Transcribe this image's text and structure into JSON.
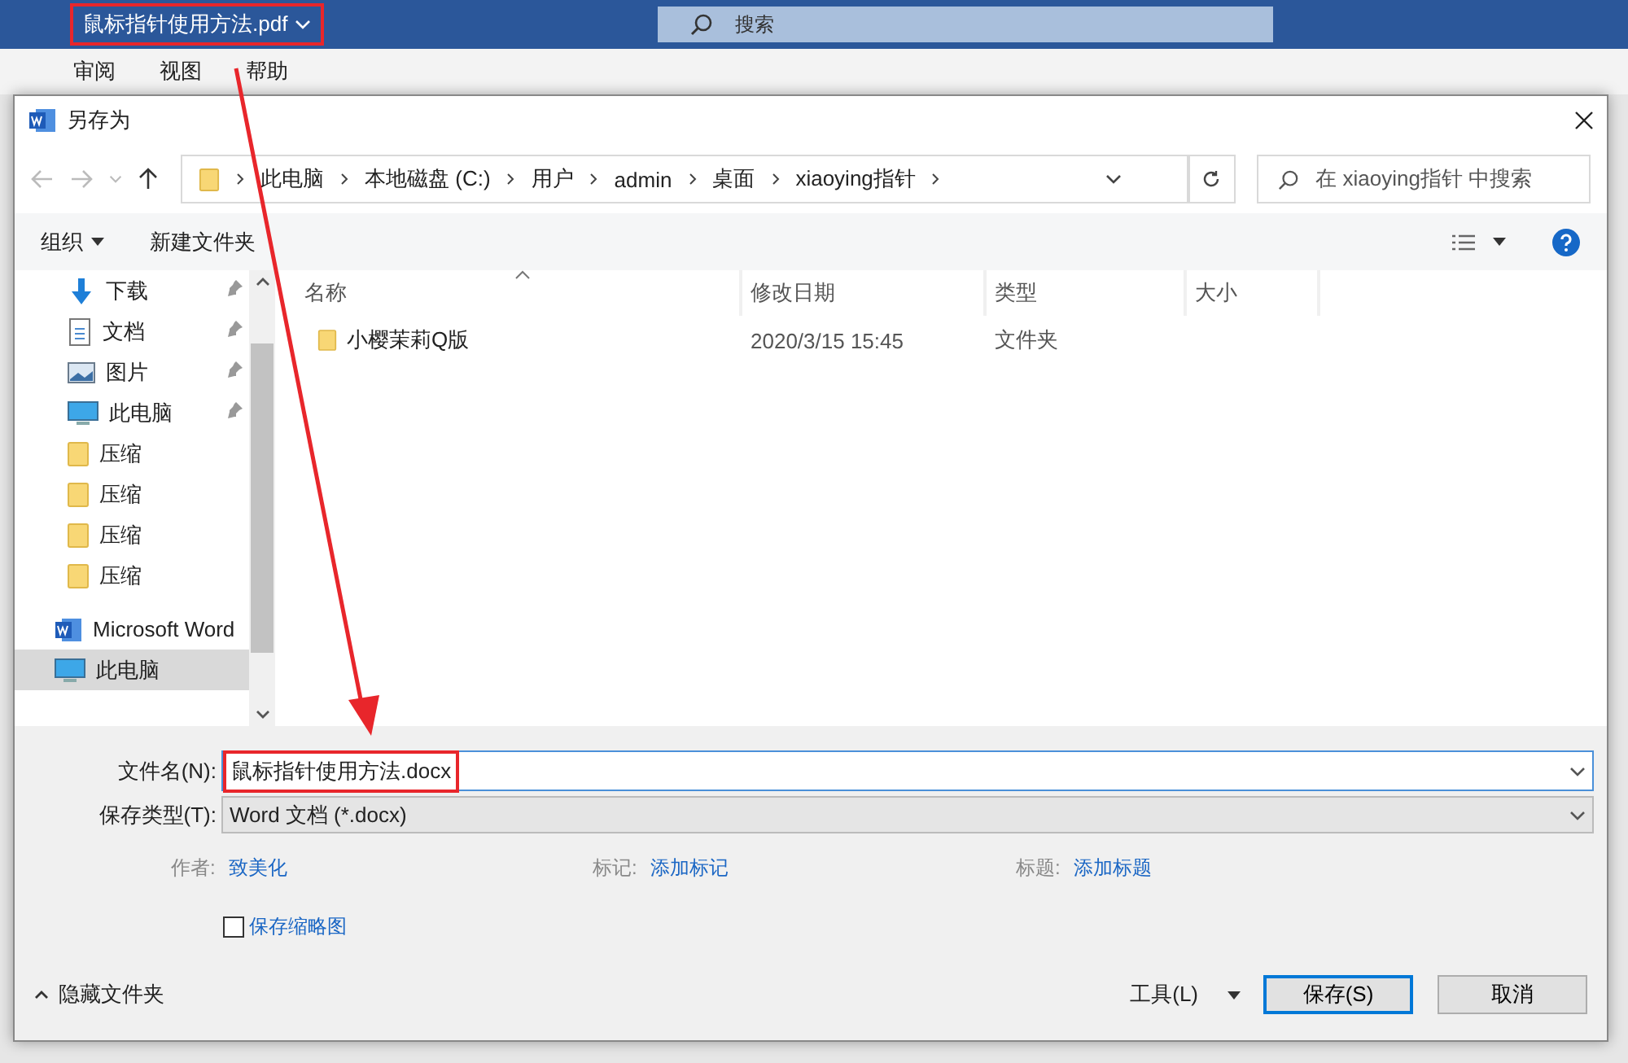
{
  "word_window": {
    "title": "鼠标指针使用方法.pdf",
    "search_placeholder": "搜索",
    "menu": [
      "审阅",
      "视图",
      "帮助"
    ]
  },
  "dialog": {
    "title": "另存为",
    "breadcrumb": [
      "此电脑",
      "本地磁盘 (C:)",
      "用户",
      "admin",
      "桌面",
      "xiaoying指针"
    ],
    "search_placeholder": "在 xiaoying指针 中搜索",
    "toolbar": [
      {
        "label": "组织",
        "kind": "menu"
      },
      {
        "label": "新建文件夹",
        "kind": "plain"
      }
    ],
    "nav_items": [
      {
        "label": "下载",
        "kind": "download",
        "pinned": true,
        "selected": false
      },
      {
        "label": "文档",
        "kind": "document",
        "pinned": true,
        "selected": false
      },
      {
        "label": "图片",
        "kind": "pictures",
        "pinned": true,
        "selected": false
      },
      {
        "label": "此电脑",
        "kind": "computer",
        "pinned": true,
        "selected": false
      },
      {
        "label": "压缩",
        "kind": "folder",
        "pinned": false,
        "selected": false
      },
      {
        "label": "压缩",
        "kind": "folder",
        "pinned": false,
        "selected": false
      },
      {
        "label": "压缩",
        "kind": "folder",
        "pinned": false,
        "selected": false
      },
      {
        "label": "压缩",
        "kind": "folder",
        "pinned": false,
        "selected": false
      },
      {
        "label": "Microsoft Word",
        "kind": "word",
        "pinned": false,
        "selected": false
      },
      {
        "label": "此电脑",
        "kind": "computer",
        "pinned": false,
        "selected": true
      }
    ],
    "columns": [
      "名称",
      "修改日期",
      "类型",
      "大小"
    ],
    "rows": [
      {
        "name": "小樱茉莉Q版",
        "modified": "2020/3/15 15:45",
        "type": "文件夹"
      }
    ],
    "filename_label": "文件名(N):",
    "filename": "鼠标指针使用方法.docx",
    "type_label": "保存类型(T):",
    "type_value": "Word 文档 (*.docx)",
    "meta": [
      {
        "label": "作者:",
        "value": "致美化"
      },
      {
        "label": "标记:",
        "value": "添加标记"
      },
      {
        "label": "标题:",
        "value": "添加标题"
      }
    ],
    "thumbnail": {
      "label": "保存缩略图",
      "checked": false
    },
    "hide_folders": "隐藏文件夹",
    "tools": "工具(L)",
    "buttons": [
      {
        "label": "保存(S)",
        "selected": true
      },
      {
        "label": "取消",
        "selected": false
      }
    ]
  }
}
